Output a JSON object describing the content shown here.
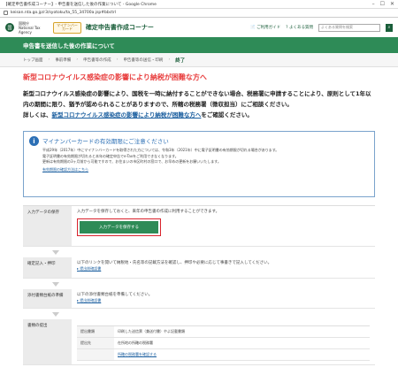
{
  "browser": {
    "window_title": "【確定申告書作成コーナー】- 申告書を送信した後の作業について - Google Chrome",
    "url": "keisan.nta.go.jp/r3/syotoku/ta_55_34700a.jsp#bbctrl"
  },
  "header": {
    "logo_label": "国",
    "agency_line1": "国税庁",
    "agency_line2": "National Tax Agency",
    "badge_line1": "マイナンバー",
    "badge_line2": "カード",
    "brand": "確定申告書作成コーナー",
    "link_guide": "ご利用ガイド",
    "link_faq": "よくある質問",
    "search_placeholder": "よくある質問を検索"
  },
  "page_title": "申告書を送信した後の作業について",
  "steps": {
    "items": [
      "トップ画面",
      "事前準備",
      "申告書等の作成",
      "申告書等の送信・印刷",
      "終了"
    ]
  },
  "notice": {
    "title": "新型コロナウイルス感染症の影響により納税が困難な方へ",
    "body": "新型コロナウイルス感染症の影響により、国税を一時に納付することができない場合、税務署に申請することにより、原則として1年以内の期間に限り、猶予が認められることがありますので、所轄の税務署（徴収担当）にご相談ください。",
    "detail_prefix": "詳しくは、",
    "detail_link": "新型コロナウイルス感染症の影響により納税が困難な方へ",
    "detail_suffix": "をご確認ください。"
  },
  "infobox": {
    "title": "マイナンバーカードの有効期限にご注意ください",
    "p1": "平成29年（2017年）中にマイナンバーカードを取得された方については、令和3年（2021年）中に電子証明書の有効期限が切れる場合があります。",
    "p2": "電子証明書の有効期限が切れると本年の確定申告でe-Taxをご利用できなくなります。",
    "p3": "更新は有効期限の3ヶ月前から可能ですので、お住まいの市区町村の窓口で、お早めの更新をお願いいたします。",
    "link": "有効期限の確認方法はこちら"
  },
  "procedure": {
    "save_label": "入力データの保存",
    "save_desc": "入力データを保存しておくと、来年の申告書の作成に利用することができます。",
    "save_button": "入力データを保存する",
    "confirm_label": "確定記入・押印",
    "confirm_desc": "以下のリンクを開いて納税地・氏名等の記載方法を確認し、押印や必要に応じて事書きで記入してください。",
    "confirm_link": "提出前確認書",
    "attach_label": "添付書類台紙の準備",
    "attach_desc": "以下の添付書類台紙を準備してください。",
    "attach_link": "提出前確認書",
    "submit_label": "書類の提出",
    "sub_rows": [
      {
        "label": "提出書類",
        "value": "印刷した送信票（兼送付書）やよ記載書類"
      },
      {
        "label": "提出先",
        "value": "在所地の所轄の税務署"
      },
      {
        "label": "",
        "value": "所轄の税務署を確認する"
      }
    ]
  }
}
